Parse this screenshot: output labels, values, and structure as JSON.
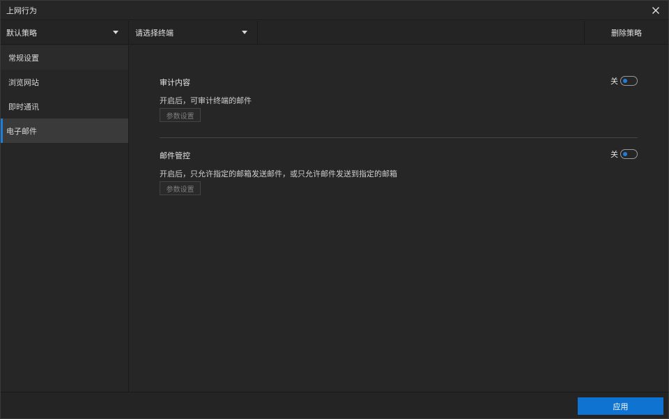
{
  "window": {
    "title": "上网行为"
  },
  "toolbar": {
    "policy_select": "默认策略",
    "terminal_select": "请选择终端",
    "delete_label": "删除策略"
  },
  "sidebar": {
    "items": [
      {
        "label": "常规设置"
      },
      {
        "label": "浏览网站"
      },
      {
        "label": "即时通讯"
      },
      {
        "label": "电子邮件"
      }
    ],
    "active": "电子邮件"
  },
  "sections": [
    {
      "title": "审计内容",
      "description": "开启后，可审计终端的邮件",
      "toggle_label": "关",
      "button_label": "参数设置"
    },
    {
      "title": "邮件管控",
      "description": "开启后，只允许指定的邮箱发送邮件，或只允许邮件发送到指定的邮箱",
      "toggle_label": "关",
      "button_label": "参数设置"
    }
  ],
  "footer": {
    "apply_label": "应用"
  },
  "colors": {
    "accent": "#1e7fd8",
    "apply": "#0f73d2",
    "background": "#262626"
  }
}
